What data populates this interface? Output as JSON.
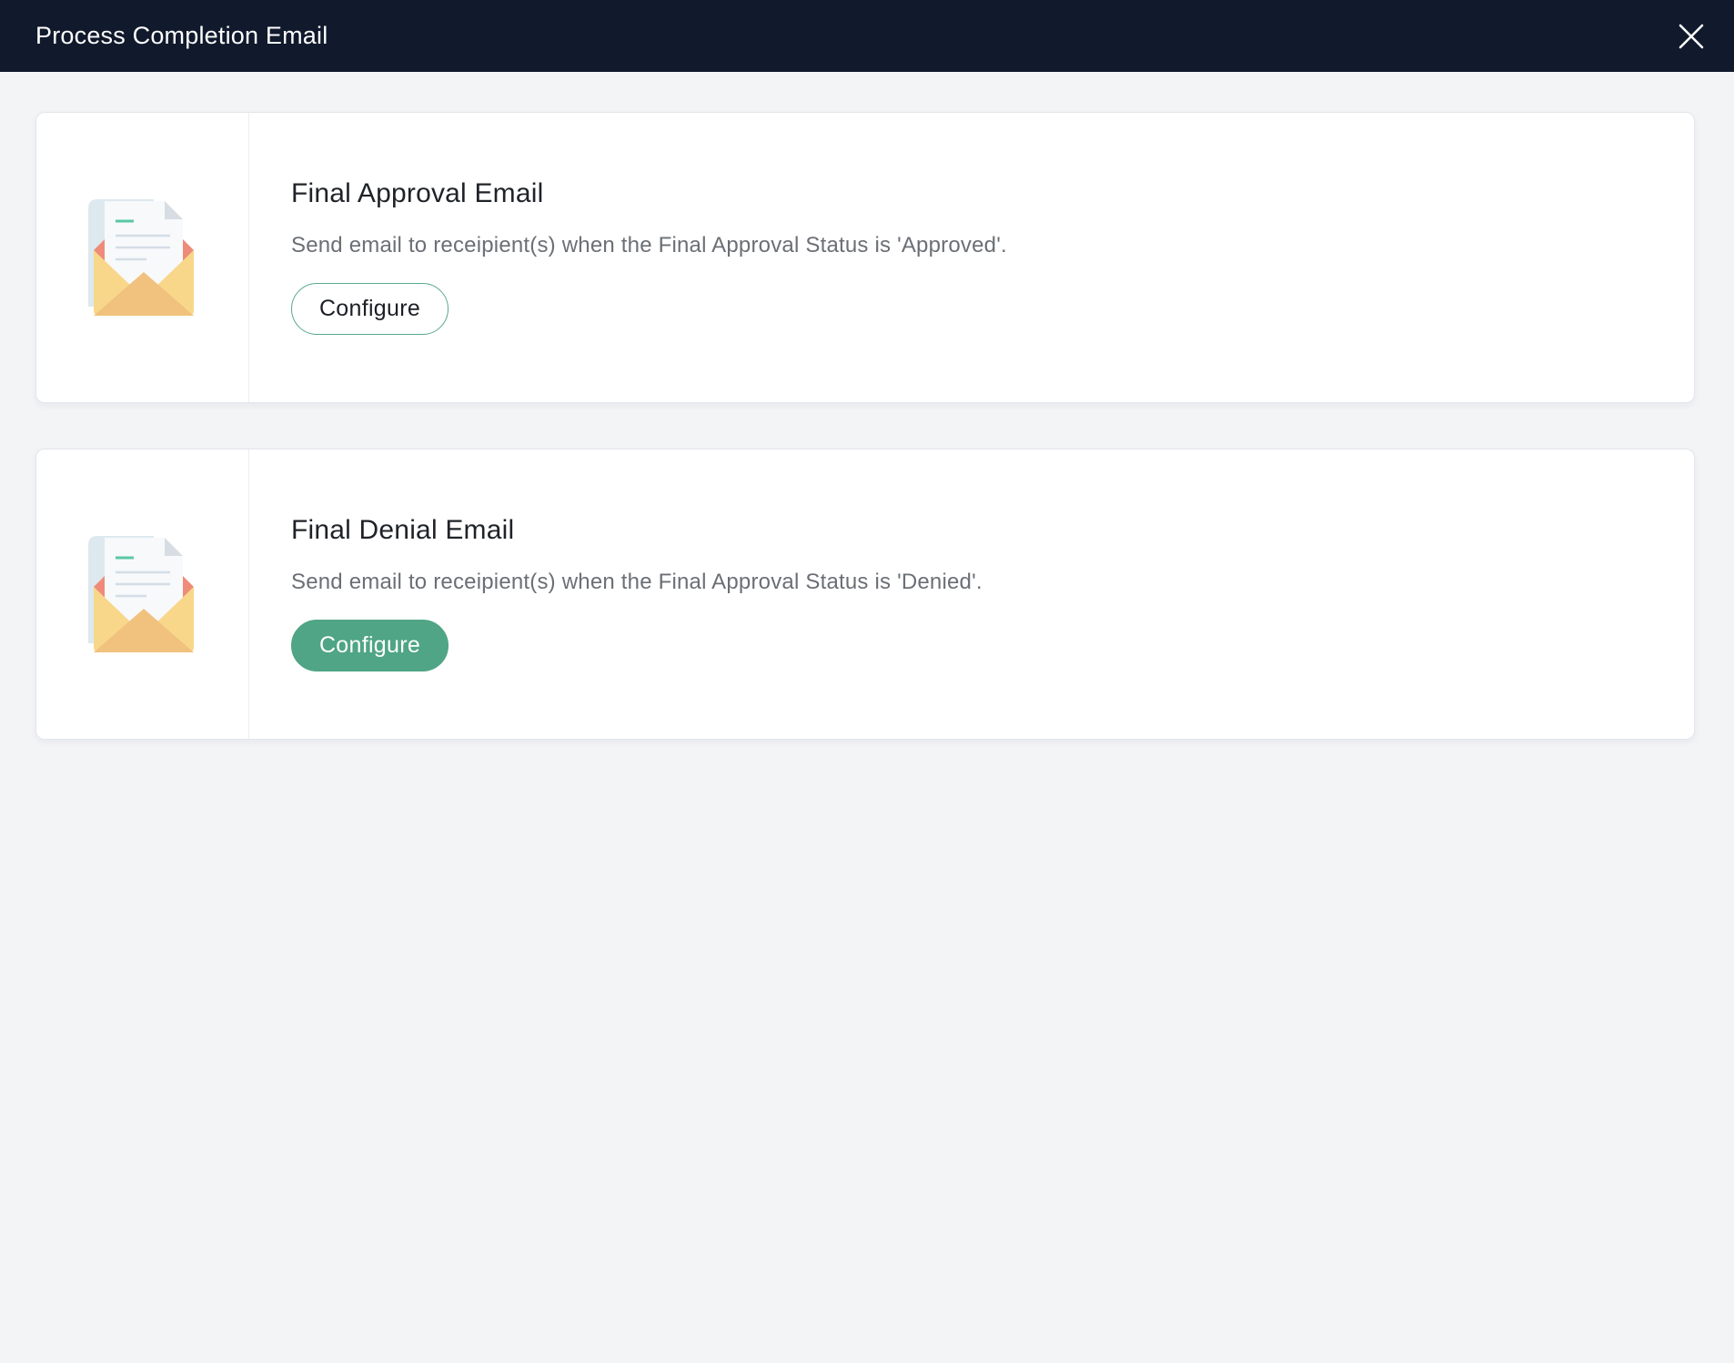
{
  "header": {
    "title": "Process Completion Email",
    "close_icon": "close-icon"
  },
  "colors": {
    "header_bg": "#111a2c",
    "page_bg": "#f3f4f6",
    "accent_green": "#4fa585"
  },
  "cards": [
    {
      "title": "Final Approval Email",
      "description": "Send email to receipient(s) when the Final Approval Status is 'Approved'.",
      "button_label": "Configure",
      "button_style": "outline",
      "icon": "envelope-letter-icon"
    },
    {
      "title": "Final Denial Email",
      "description": "Send email to receipient(s) when the Final Approval Status is 'Denied'.",
      "button_label": "Configure",
      "button_style": "filled",
      "icon": "envelope-letter-icon"
    }
  ]
}
